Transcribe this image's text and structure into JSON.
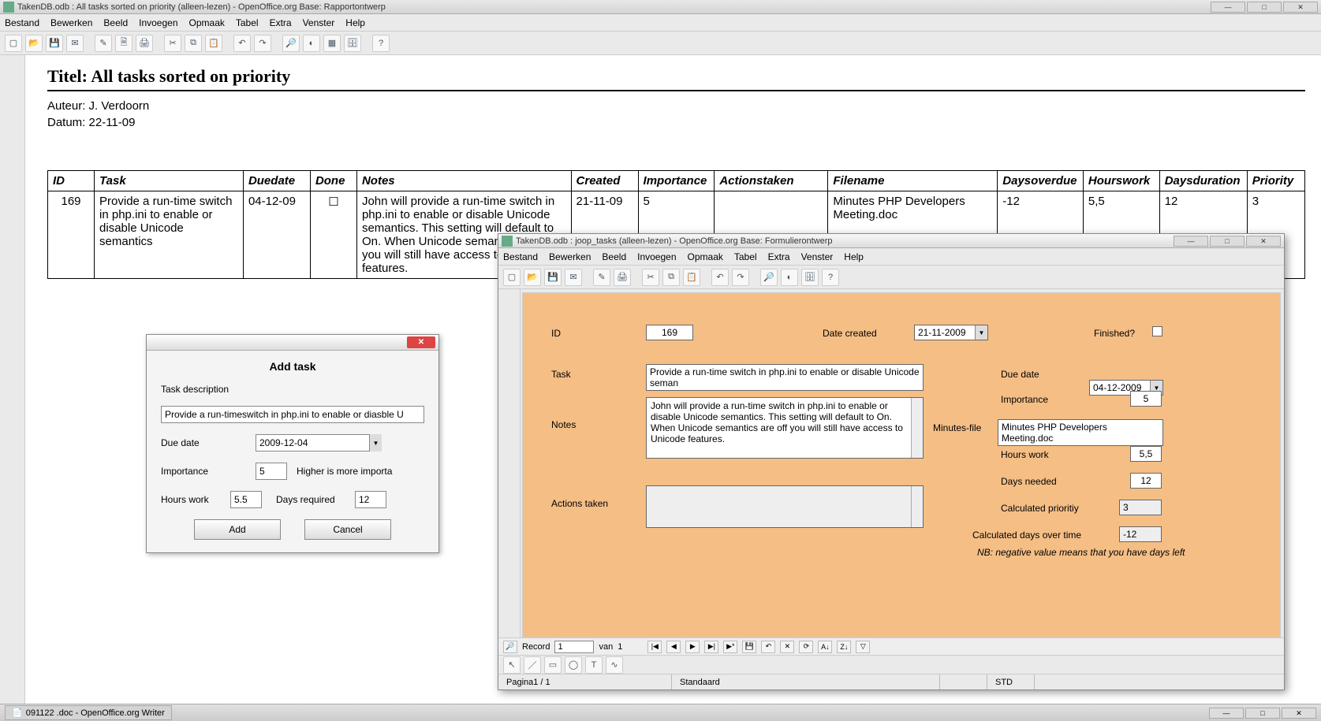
{
  "main": {
    "title": "TakenDB.odb : All tasks sorted on priority (alleen-lezen) - OpenOffice.org Base: Rapportontwerp",
    "menu": [
      "Bestand",
      "Bewerken",
      "Beeld",
      "Invoegen",
      "Opmaak",
      "Tabel",
      "Extra",
      "Venster",
      "Help"
    ]
  },
  "report": {
    "title": "Titel: All tasks sorted on priority",
    "author_line": "Auteur: J. Verdoorn",
    "date_line": "Datum: 22-11-09",
    "headers": [
      "ID",
      "Task",
      "Duedate",
      "Done",
      "Notes",
      "Created",
      "Importance",
      "Actionstaken",
      "Filename",
      "Daysoverdue",
      "Hourswork",
      "Daysduration",
      "Priority"
    ],
    "row": {
      "id": "169",
      "task": "Provide a run-time switch in php.ini to enable or disable Unicode semantics",
      "duedate": "04-12-09",
      "done": "☐",
      "notes": "John will provide a run-time switch in php.ini to enable or disable Unicode semantics. This setting will default to On. When Unicode semantics are off you will still have access to Unicode features.",
      "created": "21-11-09",
      "importance": "5",
      "actions": "",
      "filename": "Minutes PHP Developers Meeting.doc",
      "daysoverdue": "-12",
      "hourswork": "5,5",
      "daysduration": "12",
      "priority": "3"
    }
  },
  "dialog": {
    "title": "Add task",
    "desc_label": "Task description",
    "desc_value": "Provide a run-timeswitch in php.ini to enable or diasble U",
    "due_label": "Due date",
    "due_value": "2009-12-04",
    "imp_label": "Importance",
    "imp_value": "5",
    "imp_hint": "Higher is more importa",
    "hours_label": "Hours work",
    "hours_value": "5.5",
    "days_label": "Days required",
    "days_value": "12",
    "add": "Add",
    "cancel": "Cancel"
  },
  "form": {
    "title": "TakenDB.odb : joop_tasks (alleen-lezen) - OpenOffice.org Base: Formulierontwerp",
    "menu": [
      "Bestand",
      "Bewerken",
      "Beeld",
      "Invoegen",
      "Opmaak",
      "Tabel",
      "Extra",
      "Venster",
      "Help"
    ],
    "labels": {
      "id": "ID",
      "date_created": "Date created",
      "finished": "Finished?",
      "task": "Task",
      "due_date": "Due date",
      "notes": "Notes",
      "importance": "Importance",
      "minutes": "Minutes-file",
      "hours": "Hours work",
      "daysneeded": "Days needed",
      "actions": "Actions taken",
      "calcprio": "Calculated prioritiy",
      "calcover": "Calculated days over time",
      "nb": "NB: negative value means that you have days left"
    },
    "values": {
      "id": "169",
      "date_created": "21-11-2009",
      "task": "Provide a run-time switch in php.ini to enable or disable Unicode seman",
      "due_date": "04-12-2009",
      "notes": "John will provide a run-time switch in php.ini to enable or disable Unicode semantics. This setting will default to On. When Unicode semantics are off you will still have access to Unicode features.",
      "importance": "5",
      "minutes": "Minutes PHP Developers Meeting.doc",
      "hours": "5,5",
      "daysneeded": "12",
      "calcprio": "3",
      "calcover": "-12"
    },
    "nav": {
      "record_label": "Record",
      "current": "1",
      "of": "van",
      "total": "1"
    },
    "status": {
      "page": "Pagina1 / 1",
      "style": "Standaard",
      "mode": "STD"
    }
  },
  "taskbar": {
    "item": "091122 .doc - OpenOffice.org Writer"
  }
}
